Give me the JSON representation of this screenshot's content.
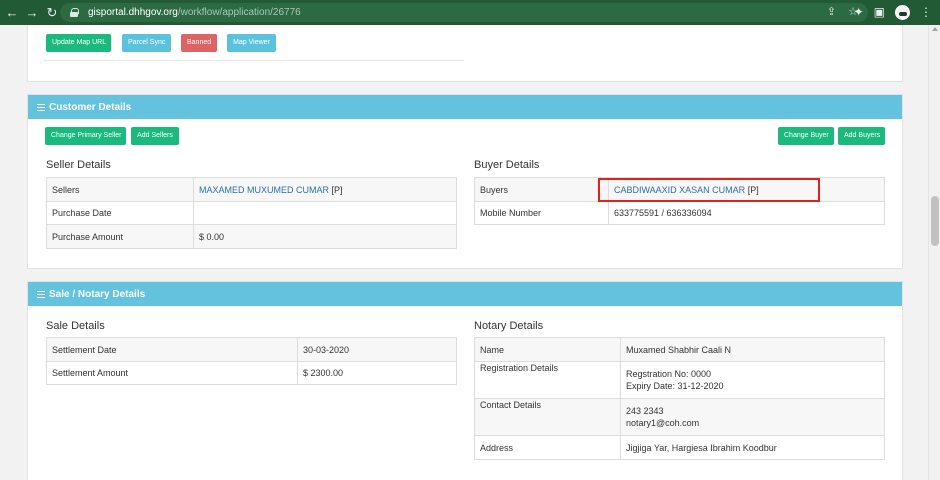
{
  "browser": {
    "nav": {
      "back": "←",
      "forward": "→",
      "reload": "↻"
    },
    "url_host": "gisportal.dhhgov.org",
    "url_path": "/workflow/application/26776",
    "icons": [
      "share-icon",
      "star-icon",
      "extension-icon",
      "sidebar-icon",
      "profile-avatar",
      "menu-icon"
    ]
  },
  "top_actions": {
    "update_map_url": "Update Map URL",
    "parcel_sync": "Parcel Sync",
    "banned": "Banned",
    "map_viewer": "Map Viewer"
  },
  "customer": {
    "title": "Customer Details",
    "change_primary_seller": "Change Primary Seller",
    "add_sellers": "Add Sellers",
    "change_buyer": "Change Buyer",
    "add_buyers": "Add Buyers",
    "seller_title": "Seller Details",
    "sellers_label": "Sellers",
    "sellers_name": "MAXAMED MUXUMED CUMAR",
    "sellers_tag": "[P]",
    "purchase_date_label": "Purchase Date",
    "purchase_date_value": "",
    "purchase_amount_label": "Purchase Amount",
    "purchase_amount_value": "$ 0.00",
    "buyer_title": "Buyer Details",
    "buyers_label": "Buyers",
    "buyers_name": "CABDIWAAXID XASAN CUMAR",
    "buyers_tag": "[P]",
    "mobile_label": "Mobile Number",
    "mobile_value": "633775591 / 636336094"
  },
  "sale": {
    "title": "Sale / Notary Details",
    "sale_title": "Sale Details",
    "settlement_date_label": "Settlement Date",
    "settlement_date_value": "30-03-2020",
    "settlement_amount_label": "Settlement Amount",
    "settlement_amount_value": "$ 2300.00",
    "notary_title": "Notary Details",
    "name_label": "Name",
    "name_value": "Muxamed Shabhir Caali N",
    "registration_label": "Registration Details",
    "registration_no": "Regstration No: 0000",
    "expiry_date": "Expiry Date: 31-12-2020",
    "contact_label": "Contact Details",
    "contact_phone": "243 2343",
    "contact_email": "notary1@coh.com",
    "address_label": "Address",
    "address_value": "Jigjiga Yar, Hargiesa Ibrahim Koodbur"
  },
  "colors": {
    "chrome": "#215a35",
    "header": "#63c3df",
    "green": "#1ab97d",
    "blue": "#5bc2de",
    "red": "#e06364",
    "link": "#2a6fb0",
    "highlight": "#e2211c"
  }
}
